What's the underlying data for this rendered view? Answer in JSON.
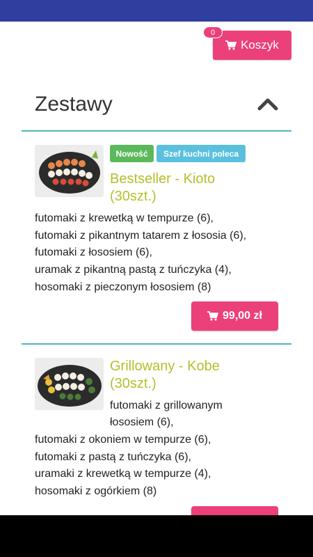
{
  "header": {
    "cart_label": "Koszyk",
    "cart_count": "0"
  },
  "section": {
    "title": "Zestawy"
  },
  "products": [
    {
      "badge_new": "Nowość",
      "badge_chef": "Szef kuchni poleca",
      "title_line1": "Bestseller - Kioto",
      "title_line2": "(30szt.)",
      "desc": [
        "futomaki z krewetką w tempurze (6),",
        "futomaki z pikantnym tatarem z łososia (6),",
        "futomaki z łososiem (6),",
        "uramak z pikantną pastą z tuńczyka (4),",
        "hosomaki z pieczonym łososiem (8)"
      ],
      "price": "99,00 zł"
    },
    {
      "title_line1": "Grillowany - Kobe",
      "title_line2": "(30szt.)",
      "desc": [
        "futomaki z grillowanym",
        "łososiem (6),",
        "futomaki z okoniem w tempurze (6),",
        "futomaki z pastą z tuńczyka (6),",
        "uramaki z krewetką w tempurze (4),",
        "hosomaki z ogórkiem (8)"
      ]
    }
  ],
  "colors": {
    "accent_pink": "#ec407a",
    "title_olive": "#b5bf2a",
    "divider_teal": "#4fb3bf",
    "status_bar": "#303f9f",
    "badge_green": "#5cb85c",
    "badge_blue": "#5bc0de"
  }
}
